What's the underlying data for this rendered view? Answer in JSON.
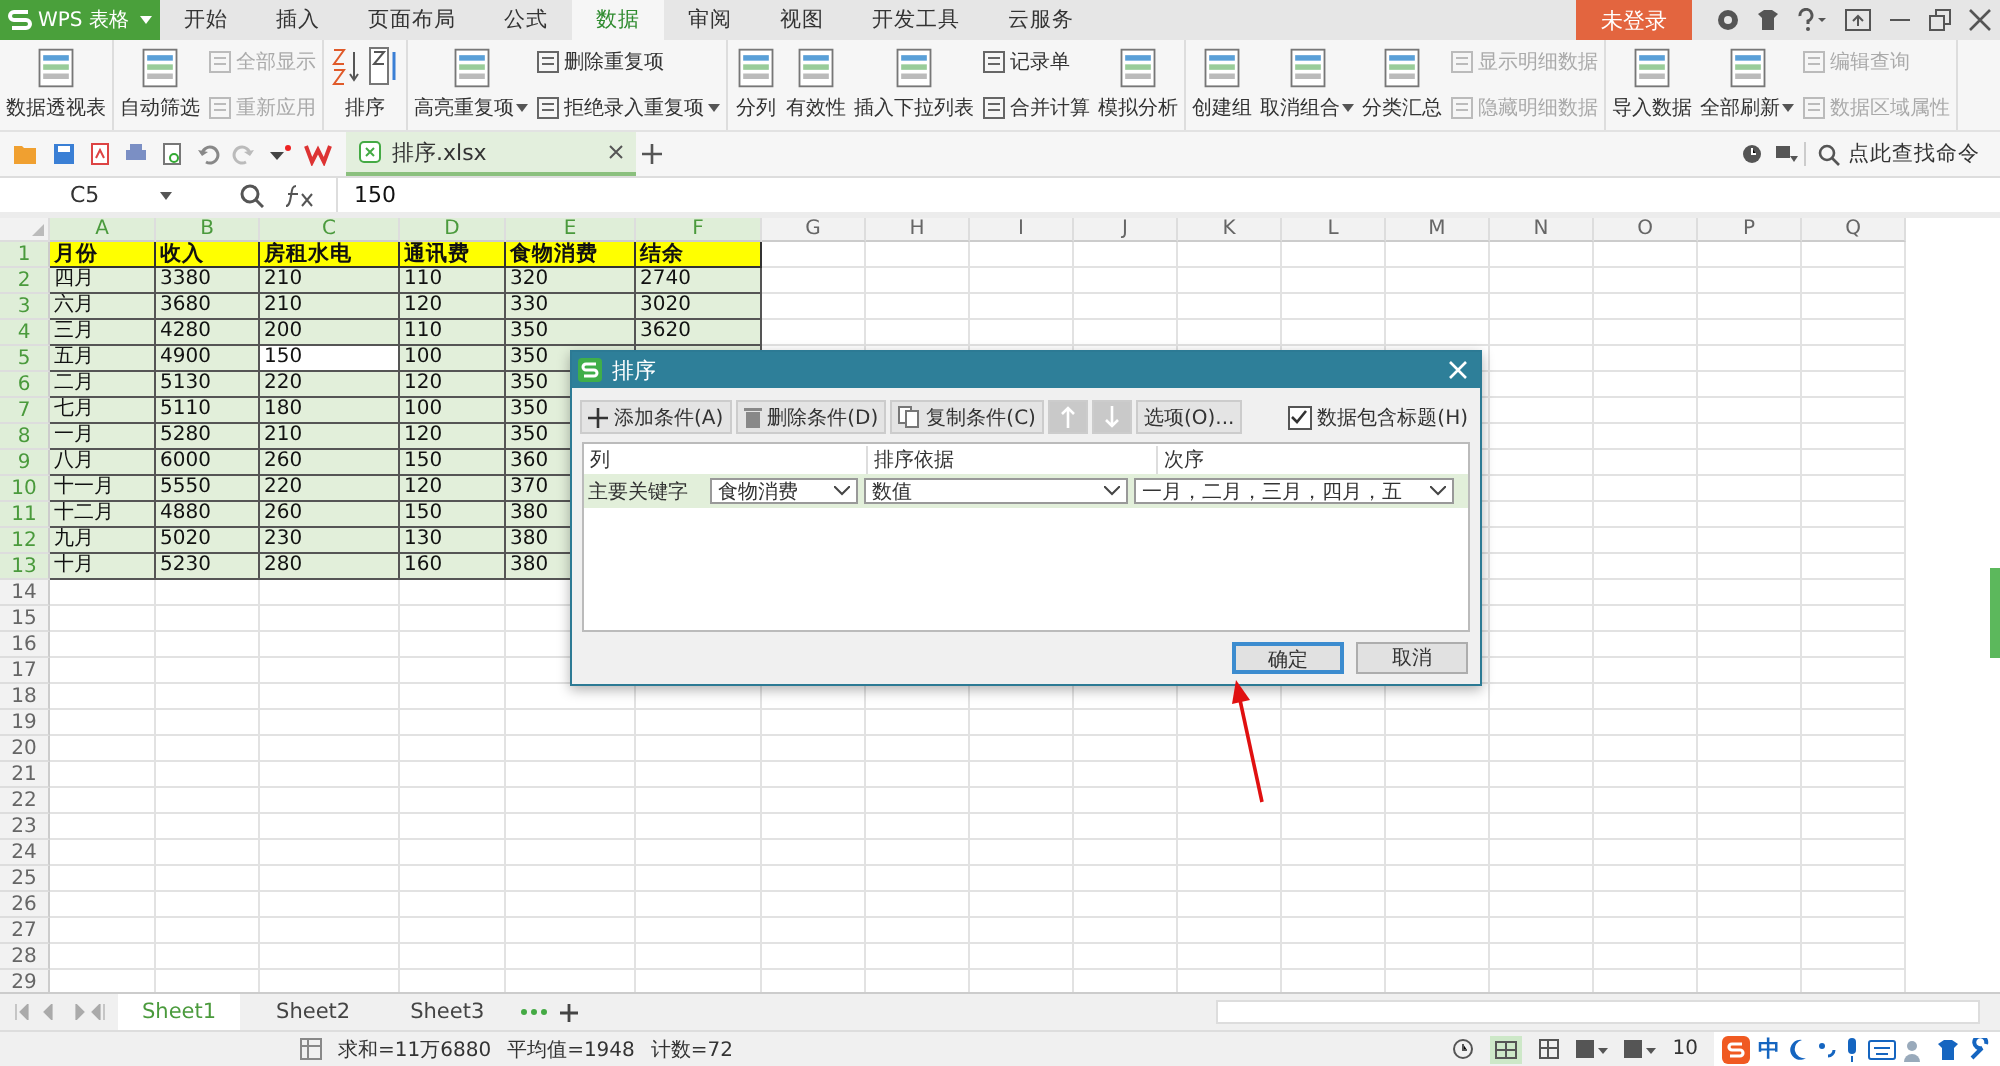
{
  "app_menu": {
    "label": "WPS 表格"
  },
  "tabs": [
    {
      "label": "开始",
      "selected": false
    },
    {
      "label": "插入",
      "selected": false
    },
    {
      "label": "页面布局",
      "selected": false
    },
    {
      "label": "公式",
      "selected": false
    },
    {
      "label": "数据",
      "selected": true
    },
    {
      "label": "审阅",
      "selected": false
    },
    {
      "label": "视图",
      "selected": false
    },
    {
      "label": "开发工具",
      "selected": false
    },
    {
      "label": "云服务",
      "selected": false
    }
  ],
  "login_button": {
    "label": "未登录"
  },
  "ribbon": [
    {
      "items": [
        {
          "kind": "large",
          "label": "数据透视表",
          "disabled": false,
          "dropdown": false
        }
      ]
    },
    {
      "items": [
        {
          "kind": "large",
          "label": "自动筛选",
          "disabled": false,
          "dropdown": false
        },
        {
          "kind": "stack",
          "items": [
            {
              "label": "全部显示",
              "disabled": true,
              "dropdown": false
            },
            {
              "label": "重新应用",
              "disabled": true,
              "dropdown": false
            }
          ]
        }
      ]
    },
    {
      "items": [
        {
          "kind": "sort",
          "label": "排序",
          "disabled": false,
          "dropdown": false
        }
      ]
    },
    {
      "items": [
        {
          "kind": "large",
          "label": "高亮重复项",
          "disabled": false,
          "dropdown": true
        },
        {
          "kind": "stack",
          "items": [
            {
              "label": "删除重复项",
              "disabled": false,
              "dropdown": false
            },
            {
              "label": "拒绝录入重复项",
              "disabled": false,
              "dropdown": true
            }
          ]
        }
      ]
    },
    {
      "items": [
        {
          "kind": "large",
          "label": "分列",
          "disabled": false,
          "dropdown": false
        },
        {
          "kind": "large",
          "label": "有效性",
          "disabled": false,
          "dropdown": false
        },
        {
          "kind": "large",
          "label": "插入下拉列表",
          "disabled": false,
          "dropdown": false
        },
        {
          "kind": "stack",
          "items": [
            {
              "label": "记录单",
              "disabled": false,
              "dropdown": false
            },
            {
              "label": "合并计算",
              "disabled": false,
              "dropdown": false
            }
          ]
        },
        {
          "kind": "large",
          "label": "模拟分析",
          "disabled": false,
          "dropdown": false
        }
      ]
    },
    {
      "items": [
        {
          "kind": "large",
          "label": "创建组",
          "disabled": false,
          "dropdown": false
        },
        {
          "kind": "large",
          "label": "取消组合",
          "disabled": false,
          "dropdown": true
        },
        {
          "kind": "large",
          "label": "分类汇总",
          "disabled": false,
          "dropdown": false
        },
        {
          "kind": "stack",
          "items": [
            {
              "label": "显示明细数据",
              "disabled": true,
              "dropdown": false
            },
            {
              "label": "隐藏明细数据",
              "disabled": true,
              "dropdown": false
            }
          ]
        }
      ]
    },
    {
      "items": [
        {
          "kind": "large",
          "label": "导入数据",
          "disabled": false,
          "dropdown": false
        },
        {
          "kind": "large",
          "label": "全部刷新",
          "disabled": false,
          "dropdown": true
        },
        {
          "kind": "stack",
          "items": [
            {
              "label": "编辑查询",
              "disabled": true,
              "dropdown": false
            },
            {
              "label": "数据区域属性",
              "disabled": true,
              "dropdown": false
            }
          ]
        }
      ]
    }
  ],
  "document_tab": {
    "label": "排序.xlsx"
  },
  "command_search": {
    "placeholder": "点此查找命令"
  },
  "name_box": {
    "value": "C5"
  },
  "formula_bar": {
    "value": "150"
  },
  "sheet": {
    "columns": [
      "A",
      "B",
      "C",
      "D",
      "E",
      "F",
      "G",
      "H",
      "I",
      "J",
      "K",
      "L",
      "M",
      "N",
      "O",
      "P",
      "Q"
    ],
    "rows": [
      {
        "number": "1",
        "kind": "header",
        "cells": [
          "月份",
          "收入",
          "房租水电",
          "通讯费",
          "食物消费",
          "结余"
        ]
      },
      {
        "number": "2",
        "kind": "data",
        "cells": [
          "四月",
          "3380",
          "210",
          "110",
          "320",
          "2740"
        ]
      },
      {
        "number": "3",
        "kind": "data",
        "cells": [
          "六月",
          "3680",
          "210",
          "120",
          "330",
          "3020"
        ]
      },
      {
        "number": "4",
        "kind": "data",
        "cells": [
          "三月",
          "4280",
          "200",
          "110",
          "350",
          "3620"
        ]
      },
      {
        "number": "5",
        "kind": "data",
        "cells": [
          "五月",
          "4900",
          "150",
          "100",
          "350"
        ]
      },
      {
        "number": "6",
        "kind": "data",
        "cells": [
          "二月",
          "5130",
          "220",
          "120",
          "350"
        ]
      },
      {
        "number": "7",
        "kind": "data",
        "cells": [
          "七月",
          "5110",
          "180",
          "100",
          "350"
        ]
      },
      {
        "number": "8",
        "kind": "data",
        "cells": [
          "一月",
          "5280",
          "210",
          "120",
          "350"
        ]
      },
      {
        "number": "9",
        "kind": "data",
        "cells": [
          "八月",
          "6000",
          "260",
          "150",
          "360"
        ]
      },
      {
        "number": "10",
        "kind": "data",
        "cells": [
          "十一月",
          "5550",
          "220",
          "120",
          "370"
        ]
      },
      {
        "number": "11",
        "kind": "data",
        "cells": [
          "十二月",
          "4880",
          "260",
          "150",
          "380"
        ]
      },
      {
        "number": "12",
        "kind": "data",
        "cells": [
          "九月",
          "5020",
          "230",
          "130",
          "380"
        ]
      },
      {
        "number": "13",
        "kind": "data",
        "cells": [
          "十月",
          "5230",
          "280",
          "160",
          "380"
        ]
      },
      {
        "number": "14",
        "kind": "empty"
      },
      {
        "number": "15",
        "kind": "empty"
      },
      {
        "number": "16",
        "kind": "empty"
      },
      {
        "number": "17",
        "kind": "empty"
      },
      {
        "number": "18",
        "kind": "empty"
      },
      {
        "number": "19",
        "kind": "empty"
      },
      {
        "number": "20",
        "kind": "empty"
      },
      {
        "number": "21",
        "kind": "empty"
      },
      {
        "number": "22",
        "kind": "empty"
      },
      {
        "number": "23",
        "kind": "empty"
      },
      {
        "number": "24",
        "kind": "empty"
      },
      {
        "number": "25",
        "kind": "empty"
      },
      {
        "number": "26",
        "kind": "empty"
      },
      {
        "number": "27",
        "kind": "empty"
      },
      {
        "number": "28",
        "kind": "empty"
      },
      {
        "number": "29",
        "kind": "empty"
      }
    ]
  },
  "sort_dialog": {
    "title": "排序",
    "toolbar": [
      {
        "kind": "add",
        "label": "添加条件(A)",
        "disabled": false
      },
      {
        "kind": "delete",
        "label": "删除条件(D)",
        "disabled": false
      },
      {
        "kind": "copy",
        "label": "复制条件(C)",
        "disabled": false
      },
      {
        "kind": "up",
        "disabled": true
      },
      {
        "kind": "down",
        "disabled": true
      },
      {
        "kind": "text",
        "label": "选项(O)...",
        "disabled": false
      }
    ],
    "has_header_checkbox": {
      "label": "数据包含标题(H)",
      "checked": true
    },
    "columns": [
      "列",
      "排序依据",
      "次序"
    ],
    "conditions": [
      {
        "label": "主要关键字",
        "column": "食物消费",
        "sort_on": "数值",
        "order": "一月，二月，三月，四月，五"
      }
    ],
    "buttons": [
      {
        "label": "确定",
        "default": true
      },
      {
        "label": "取消",
        "default": false
      }
    ]
  },
  "sheet_tabs": [
    {
      "label": "Sheet1",
      "selected": true
    },
    {
      "label": "Sheet2",
      "selected": false
    },
    {
      "label": "Sheet3",
      "selected": false
    }
  ],
  "status_bar": {
    "sum": "求和=11万6880",
    "average": "平均值=1948",
    "count": "计数=72",
    "zoom": "10",
    "ime": "中"
  }
}
